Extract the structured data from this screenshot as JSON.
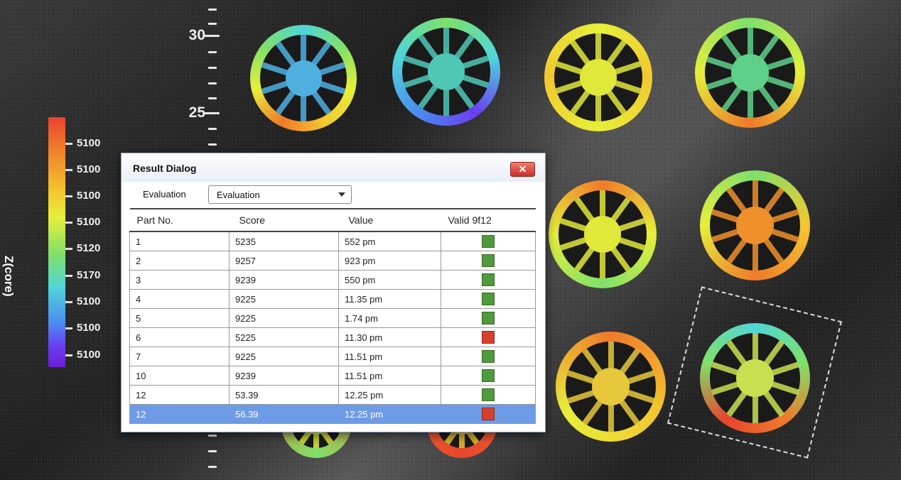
{
  "ruler": {
    "labels": [
      "30",
      "25"
    ]
  },
  "colorbar": {
    "axis_label": "Z(core)",
    "ticks": [
      "5100",
      "5100",
      "5100",
      "5100",
      "5120",
      "5170",
      "5100",
      "5100",
      "5100"
    ]
  },
  "dialog": {
    "title": "Result Dialog",
    "close_label": "✕",
    "evaluation_label": "Evaluation",
    "evaluation_value": "Evaluation",
    "columns": [
      "Part No.",
      "Score",
      "Value",
      "Valid 9f12"
    ],
    "rows": [
      {
        "part": "1",
        "score": "5235",
        "value": "552 pm",
        "status": "ok"
      },
      {
        "part": "2",
        "score": "9257",
        "value": "923 pm",
        "status": "ok"
      },
      {
        "part": "3",
        "score": "9239",
        "value": "550 pm",
        "status": "ok"
      },
      {
        "part": "4",
        "score": "9225",
        "value": "11.35 pm",
        "status": "ok"
      },
      {
        "part": "5",
        "score": "9225",
        "value": "1.74 pm",
        "status": "ok"
      },
      {
        "part": "6",
        "score": "5225",
        "value": "11.30 pm",
        "status": "bad"
      },
      {
        "part": "7",
        "score": "9225",
        "value": "11.51 pm",
        "status": "ok"
      },
      {
        "part": "10",
        "score": "9239",
        "value": "11.51 pm",
        "status": "ok"
      },
      {
        "part": "12",
        "score": "53.39",
        "value": "12.25 pm",
        "status": "ok"
      },
      {
        "part": "12",
        "score": "56.39",
        "value": "12.25 pm",
        "status": "bad",
        "selected": true
      }
    ]
  },
  "colors": {
    "ok": "#4e9a3c",
    "bad": "#d9402c",
    "selection": "#6e9be6"
  }
}
